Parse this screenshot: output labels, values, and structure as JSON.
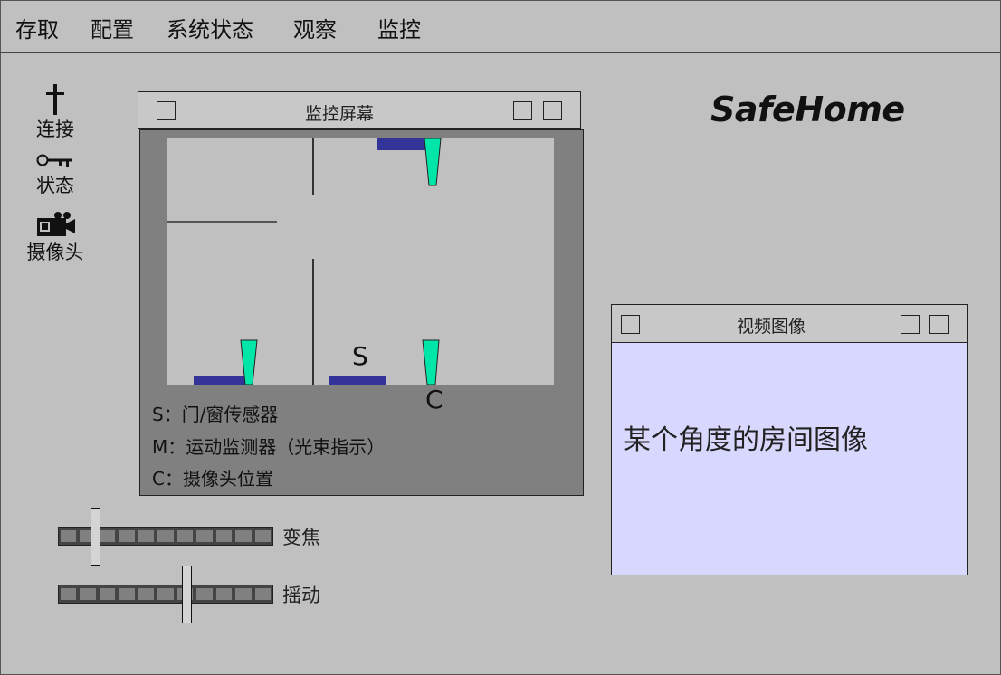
{
  "menu": {
    "items": [
      "存取",
      "配置",
      "系统状态",
      "观察",
      "监控"
    ]
  },
  "tools": {
    "connect": {
      "label": "连接",
      "icon": "cross-icon"
    },
    "status": {
      "label": "状态",
      "icon": "key-icon"
    },
    "camera": {
      "label": "摄像头",
      "icon": "video-camera-icon"
    }
  },
  "brand": {
    "name": "SafeHome"
  },
  "monitor_window": {
    "title": "监控屏幕",
    "markers": {
      "sensor": "S",
      "camera": "C"
    },
    "legend": {
      "sensor": "S：门/窗传感器",
      "motion": "M：运动监测器（光束指示）",
      "camera": "C：摄像头位置"
    },
    "colors": {
      "floor": "#c0c0c0",
      "sensor": "#333399",
      "camera": "#00e6a8"
    }
  },
  "video_window": {
    "title": "视频图像",
    "caption": "某个角度的房间图像",
    "background": "#d8d8ff"
  },
  "sliders": {
    "zoom": {
      "label": "变焦",
      "value": 0.16
    },
    "pan": {
      "label": "摇动",
      "value": 0.61
    }
  }
}
